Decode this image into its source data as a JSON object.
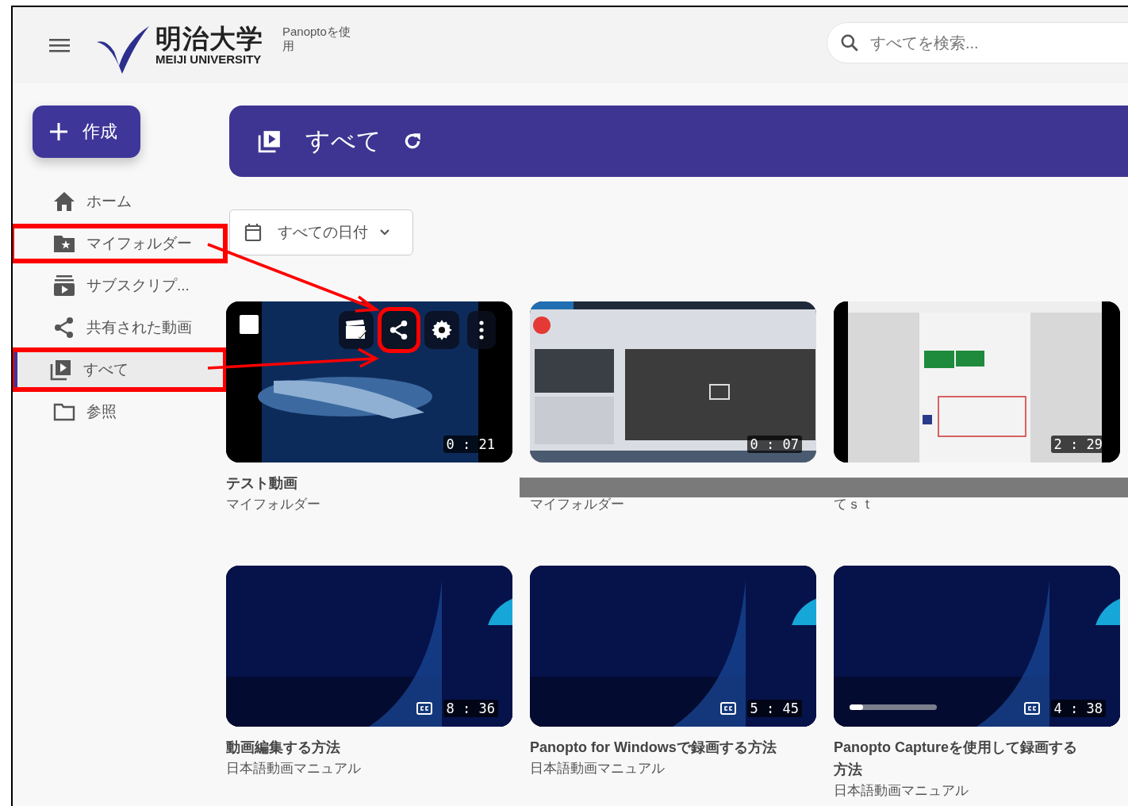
{
  "header": {
    "logo_kanji": "明治大学",
    "logo_english": "MEIJI UNIVERSITY",
    "app_label": "Panoptoを使用",
    "search": {
      "placeholder": "すべてを検索..."
    }
  },
  "create_button": {
    "label": "作成"
  },
  "sidebar": {
    "items": [
      {
        "kind": "home",
        "label": "ホーム",
        "selected": false,
        "highlighted": false
      },
      {
        "kind": "star-folder",
        "label": "マイフォルダー",
        "selected": false,
        "highlighted": true
      },
      {
        "kind": "subscriptions",
        "label": "サブスクリプ...",
        "selected": false,
        "highlighted": false
      },
      {
        "kind": "share",
        "label": "共有された動画",
        "selected": false,
        "highlighted": false
      },
      {
        "kind": "library",
        "label": "すべて",
        "selected": true,
        "highlighted": true
      },
      {
        "kind": "folder",
        "label": "参照",
        "selected": false,
        "highlighted": false
      }
    ]
  },
  "banner": {
    "title": "すべて"
  },
  "date_filter": {
    "label": "すべての日付"
  },
  "videos": [
    {
      "kind": "dolphin",
      "hover": true,
      "checked": false,
      "share_highlighted": true,
      "cc": false,
      "duration": "0 : 21",
      "title": "テスト動画",
      "folder": "マイフォルダー"
    },
    {
      "kind": "app",
      "hover": false,
      "cc": false,
      "duration": "0 : 07",
      "folder": "マイフォルダー"
    },
    {
      "kind": "document",
      "hover": false,
      "cc": false,
      "duration": "2 : 29",
      "folder": "てｓｔ"
    },
    {
      "kind": "slide",
      "hover": false,
      "cc": true,
      "duration": "8 : 36",
      "title": "動画編集する方法",
      "folder": "日本語動画マニュアル"
    },
    {
      "kind": "slide",
      "hover": false,
      "cc": true,
      "duration": "5 : 45",
      "title": "Panopto for Windowsで録画する方法",
      "folder": "日本語動画マニュアル"
    },
    {
      "kind": "slide",
      "hover": false,
      "cc": true,
      "duration": "4 : 38",
      "level": 0.15,
      "title": "Panopto Captureを使用して録画する方法",
      "folder": "日本語動画マニュアル"
    }
  ],
  "redaction_bar": true
}
